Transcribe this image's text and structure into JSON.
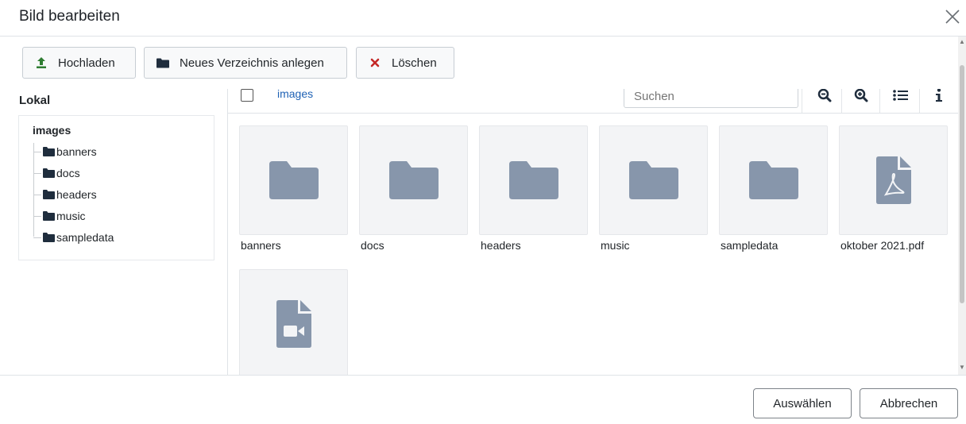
{
  "dialog": {
    "title": "Bild bearbeiten",
    "close_icon": "close-icon"
  },
  "toolbar": {
    "upload_label": "Hochladen",
    "new_folder_label": "Neues Verzeichnis anlegen",
    "delete_label": "Löschen",
    "colors": {
      "upload_icon": "#2f7d32",
      "delete_icon": "#c52827",
      "folder_icon": "#1f2d3d"
    }
  },
  "sidebar": {
    "title": "Lokal",
    "root": "images",
    "items": [
      {
        "label": "banners"
      },
      {
        "label": "docs"
      },
      {
        "label": "headers"
      },
      {
        "label": "music"
      },
      {
        "label": "sampledata"
      }
    ]
  },
  "browser": {
    "breadcrumb": "images",
    "search_placeholder": "Suchen",
    "tiles": [
      {
        "label": "banners",
        "icon": "folder-icon"
      },
      {
        "label": "docs",
        "icon": "folder-icon"
      },
      {
        "label": "headers",
        "icon": "folder-icon"
      },
      {
        "label": "music",
        "icon": "folder-icon"
      },
      {
        "label": "sampledata",
        "icon": "folder-icon"
      },
      {
        "label": "oktober 2021.pdf",
        "icon": "pdf-file-icon"
      },
      {
        "label": "",
        "icon": "video-file-icon"
      }
    ]
  },
  "footer": {
    "select_label": "Auswählen",
    "cancel_label": "Abbrechen"
  },
  "colors": {
    "link": "#1f62b5",
    "tile_bg": "#f3f4f6",
    "tile_icon": "#8796ab",
    "tree_folder": "#1f2d3d"
  }
}
